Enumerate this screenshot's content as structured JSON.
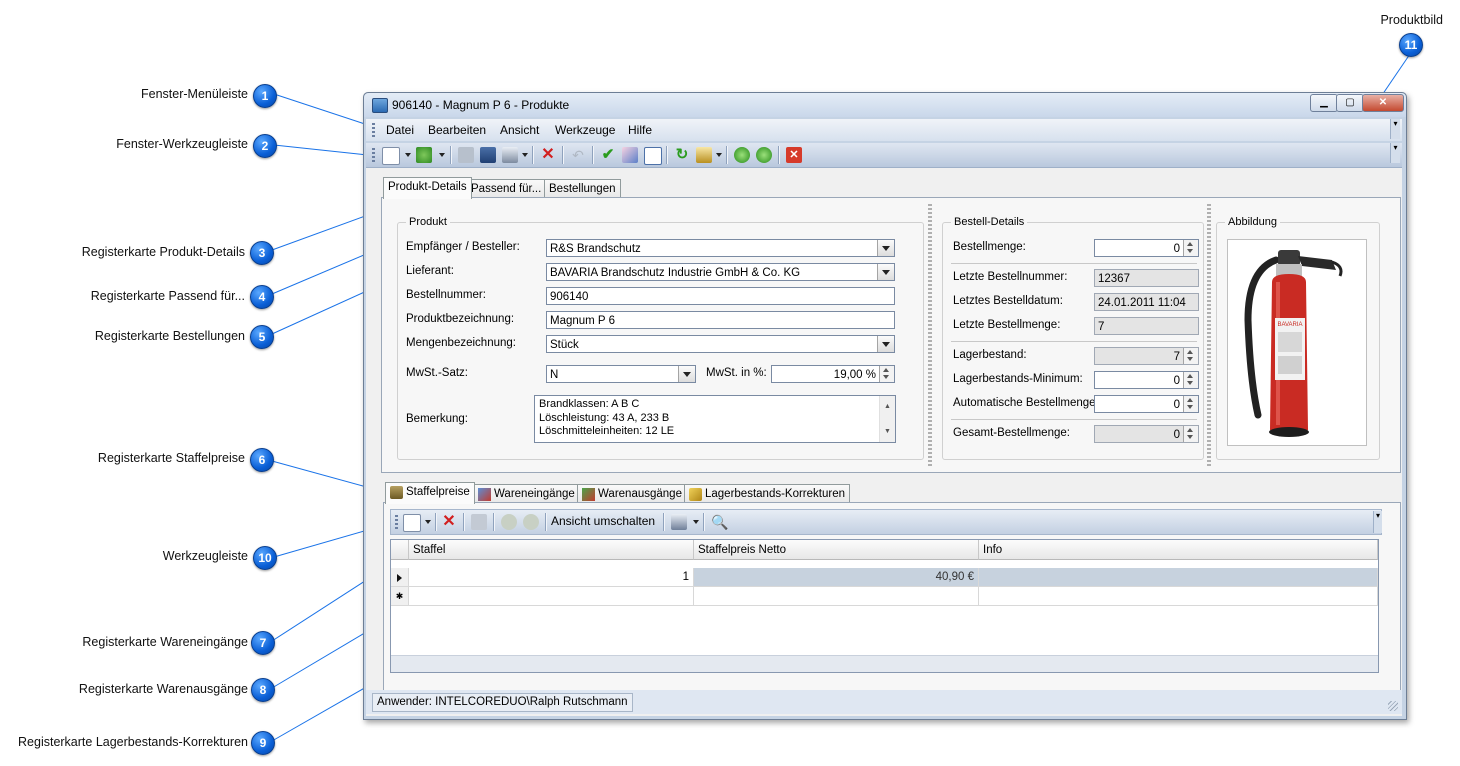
{
  "window": {
    "title": "906140 - Magnum P 6 - Produkte",
    "menu": [
      "Datei",
      "Bearbeiten",
      "Ansicht",
      "Werkzeuge",
      "Hilfe"
    ]
  },
  "tabs_top": [
    "Produkt-Details",
    "Passend für...",
    "Bestellungen"
  ],
  "produkt": {
    "group_title": "Produkt",
    "empfaenger_label": "Empfänger / Besteller:",
    "empfaenger_value": "R&S Brandschutz",
    "lieferant_label": "Lieferant:",
    "lieferant_value": "BAVARIA Brandschutz Industrie GmbH & Co. KG",
    "bestellnummer_label": "Bestellnummer:",
    "bestellnummer_value": "906140",
    "produktbez_label": "Produktbezeichnung:",
    "produktbez_value": "Magnum P 6",
    "mengenbez_label": "Mengenbezeichnung:",
    "mengenbez_value": "Stück",
    "mwst_satz_label": "MwSt.-Satz:",
    "mwst_satz_value": "N",
    "mwst_prozent_label": "MwSt. in %:",
    "mwst_prozent_value": "19,00 %",
    "bemerkung_label": "Bemerkung:",
    "bemerkung_lines": [
      "Brandklassen: A B C",
      "Löschleistung: 43 A, 233 B",
      "Löschmitteleinheiten: 12 LE"
    ]
  },
  "bestell": {
    "group_title": "Bestell-Details",
    "bestellmenge_label": "Bestellmenge:",
    "bestellmenge_value": "0",
    "letzte_nr_label": "Letzte Bestellnummer:",
    "letzte_nr_value": "12367",
    "letztes_datum_label": "Letztes Bestelldatum:",
    "letztes_datum_value": "24.01.2011 11:04",
    "letzte_menge_label": "Letzte Bestellmenge:",
    "letzte_menge_value": "7",
    "lagerbestand_label": "Lagerbestand:",
    "lagerbestand_value": "7",
    "lager_min_label": "Lagerbestands-Minimum:",
    "lager_min_value": "0",
    "auto_menge_label": "Automatische Bestellmenge:",
    "auto_menge_value": "0",
    "gesamt_label": "Gesamt-Bestellmenge:",
    "gesamt_value": "0"
  },
  "abbildung": {
    "group_title": "Abbildung",
    "product_label": "BAVARIA"
  },
  "tabs_bottom": [
    "Staffelpreise",
    "Wareneingänge",
    "Warenausgänge",
    "Lagerbestands-Korrekturen"
  ],
  "sub_toolbar": {
    "toggle_view": "Ansicht umschalten"
  },
  "grid": {
    "columns": [
      "Staffel",
      "Staffelpreis Netto",
      "Info"
    ],
    "rows": [
      [
        "1",
        "40,90 €",
        ""
      ]
    ]
  },
  "status": {
    "user": "Anwender: INTELCOREDUO\\Ralph Rutschmann"
  },
  "callouts": {
    "c1": "Fenster-Menüleiste",
    "c2": "Fenster-Werkzeugleiste",
    "c3": "Registerkarte Produkt-Details",
    "c4": "Registerkarte Passend für...",
    "c5": "Registerkarte Bestellungen",
    "c6": "Registerkarte Staffelpreise",
    "c10": "Werkzeugleiste",
    "c7": "Registerkarte Wareneingänge",
    "c8": "Registerkarte Warenausgänge",
    "c9": "Registerkarte Lagerbestands-Korrekturen",
    "c11": "Produktbild",
    "numbers": [
      "1",
      "2",
      "3",
      "4",
      "5",
      "6",
      "7",
      "8",
      "9",
      "10",
      "11"
    ]
  },
  "colors": {
    "callout_badge": "#0a5fd6",
    "callout_line": "#1a73e8",
    "window_frame": "#c5d3e4"
  }
}
